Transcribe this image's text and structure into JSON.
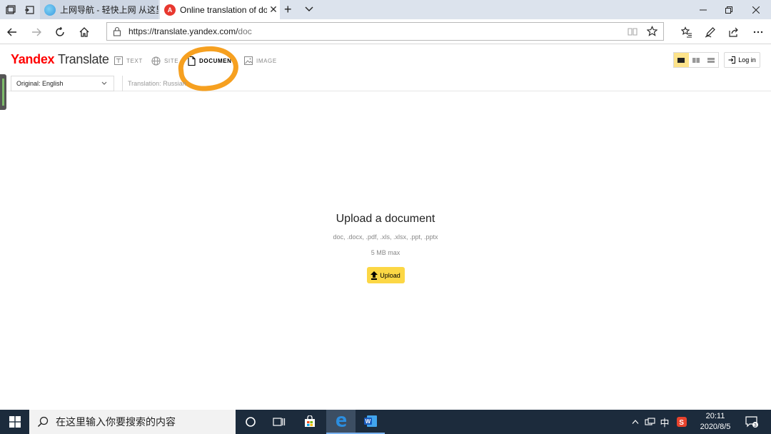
{
  "browser": {
    "tabs": [
      {
        "title": "上网导航 - 轻快上网 从这里"
      },
      {
        "title": "Online translation of do"
      }
    ],
    "address": {
      "host": "https://translate.yandex.com/",
      "path": "doc"
    }
  },
  "yandex": {
    "logo_brand": "Yandex",
    "logo_product": "Translate",
    "nav": [
      {
        "label": "TEXT"
      },
      {
        "label": "SITE"
      },
      {
        "label": "DOCUMENT"
      },
      {
        "label": "IMAGE"
      }
    ],
    "login_label": "Log in",
    "original_lang": "Original: English",
    "translation_lang": "Translation: Russian"
  },
  "upload": {
    "title": "Upload a document",
    "types": "doc, .docx, .pdf, .xls, .xlsx, .ppt, .pptx",
    "max": "5 MB max",
    "button": "Upload"
  },
  "taskbar": {
    "search_placeholder": "在这里输入你要搜索的内容",
    "ime": "中",
    "time": "20:11",
    "date": "2020/8/5",
    "notif_count": "3"
  },
  "colors": {
    "accent_yellow": "#fcd745",
    "highlight_orange": "#f6a020",
    "yandex_red": "#ff0000",
    "taskbar": "#1c2b3c"
  }
}
